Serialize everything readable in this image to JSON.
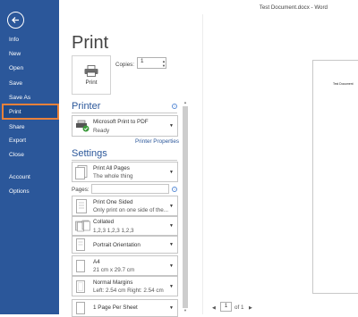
{
  "window": {
    "title": "Test Document.docx - Word"
  },
  "nav": {
    "items": [
      {
        "label": "Info"
      },
      {
        "label": "New"
      },
      {
        "label": "Open"
      },
      {
        "label": "Save"
      },
      {
        "label": "Save As"
      },
      {
        "label": "Print"
      },
      {
        "label": "Share"
      },
      {
        "label": "Export"
      },
      {
        "label": "Close"
      },
      {
        "label": "Account"
      },
      {
        "label": "Options"
      }
    ],
    "active": "Print"
  },
  "print": {
    "heading": "Print",
    "button_label": "Print",
    "copies_label": "Copies:",
    "copies_value": "1"
  },
  "printer": {
    "heading": "Printer",
    "name": "Microsoft Print to PDF",
    "status": "Ready",
    "properties_link": "Printer Properties"
  },
  "settings": {
    "heading": "Settings",
    "pages_label": "Pages:",
    "items": [
      {
        "line1": "Print All Pages",
        "line2": "The whole thing"
      },
      {
        "line1": "Print One Sided",
        "line2": "Only print on one side of the..."
      },
      {
        "line1": "Collated",
        "line2": "1,2,3    1,2,3    1,2,3"
      },
      {
        "line1": "Portrait Orientation",
        "line2": ""
      },
      {
        "line1": "A4",
        "line2": "21 cm x 29.7 cm"
      },
      {
        "line1": "Normal Margins",
        "line2": "Left:  2.54 cm    Right:  2.54 cm"
      },
      {
        "line1": "1 Page Per Sheet",
        "line2": ""
      }
    ]
  },
  "preview": {
    "page_text": "Test Document",
    "current_page": "1",
    "of_label": "of 1"
  },
  "colors": {
    "nav_bg": "#2b579a",
    "accent": "#2b579a",
    "active_outline": "#e8813a"
  }
}
